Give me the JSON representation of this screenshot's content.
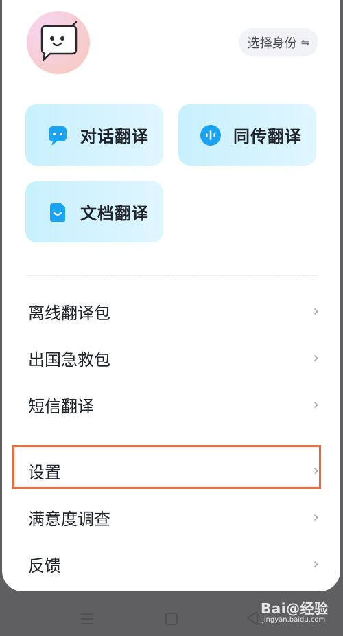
{
  "header": {
    "avatar_icon": "chat-bubble-mascot-icon",
    "identity_label": "选择身份",
    "identity_icon": "swap-icon"
  },
  "cards": [
    {
      "label": "对话翻译",
      "icon": "dialogue-icon"
    },
    {
      "label": "同传翻译",
      "icon": "voice-wave-icon"
    },
    {
      "label": "文档翻译",
      "icon": "document-icon"
    }
  ],
  "menu": [
    {
      "label": "离线翻译包"
    },
    {
      "label": "出国急救包"
    },
    {
      "label": "短信翻译"
    },
    {
      "label": "设置"
    },
    {
      "label": "满意度调查"
    },
    {
      "label": "反馈"
    }
  ],
  "watermark": {
    "brand": "Bai@经验",
    "url": "jingyan.baidu.com"
  },
  "colors": {
    "highlight": "#ec6a3d",
    "card_bg": "#c8f0fd",
    "icon_blue": "#1aa3f0"
  }
}
